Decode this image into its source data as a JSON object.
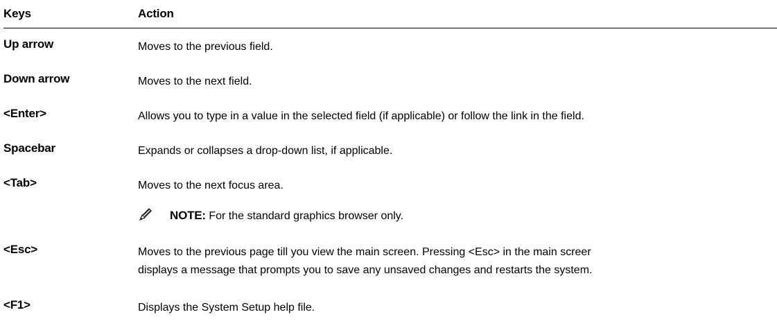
{
  "table": {
    "header": {
      "keys": "Keys",
      "action": "Action"
    },
    "rows": [
      {
        "key": "Up arrow",
        "action": "Moves to the previous field."
      },
      {
        "key": "Down arrow",
        "action": "Moves to the next field."
      },
      {
        "key": "<Enter>",
        "action": "Allows you to type in a value in the selected field (if applicable) or follow the link in the field."
      },
      {
        "key": "Spacebar",
        "action": "Expands or collapses a drop-down list, if applicable."
      },
      {
        "key": "<Tab>",
        "action": "Moves to the next focus area."
      },
      {
        "key": "<Esc>",
        "action_line1": "Moves to the previous page till you view the main screen. Pressing <Esc> in the main screer",
        "action_line2": "displays a message that prompts you to save any unsaved changes and restarts the system."
      },
      {
        "key": "<F1>",
        "action": "Displays the System Setup help file."
      }
    ],
    "note": {
      "label": "NOTE:",
      "text": " For the standard graphics browser only.",
      "icon": "pencil-note-icon"
    }
  }
}
